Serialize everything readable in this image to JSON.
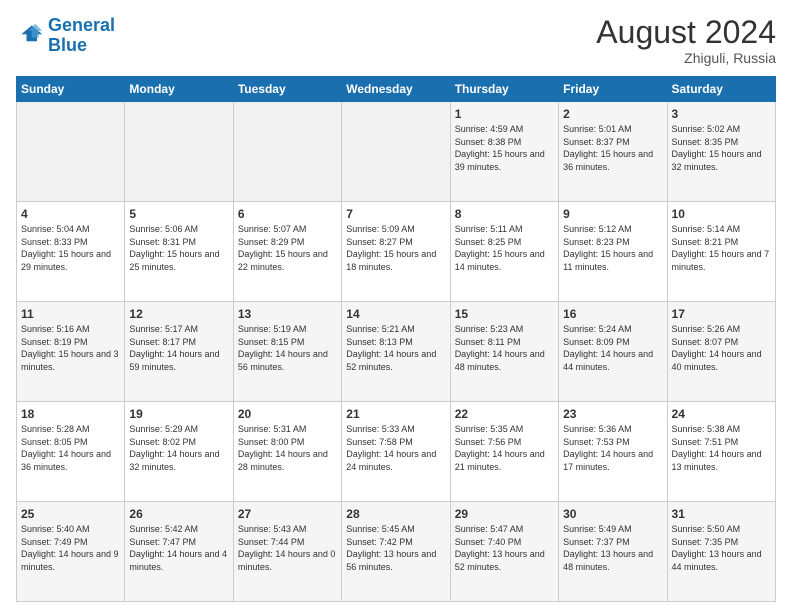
{
  "header": {
    "logo_line1": "General",
    "logo_line2": "Blue",
    "month_year": "August 2024",
    "location": "Zhiguli, Russia"
  },
  "weekdays": [
    "Sunday",
    "Monday",
    "Tuesday",
    "Wednesday",
    "Thursday",
    "Friday",
    "Saturday"
  ],
  "weeks": [
    [
      {
        "day": "",
        "info": ""
      },
      {
        "day": "",
        "info": ""
      },
      {
        "day": "",
        "info": ""
      },
      {
        "day": "",
        "info": ""
      },
      {
        "day": "1",
        "info": "Sunrise: 4:59 AM\nSunset: 8:38 PM\nDaylight: 15 hours and 39 minutes."
      },
      {
        "day": "2",
        "info": "Sunrise: 5:01 AM\nSunset: 8:37 PM\nDaylight: 15 hours and 36 minutes."
      },
      {
        "day": "3",
        "info": "Sunrise: 5:02 AM\nSunset: 8:35 PM\nDaylight: 15 hours and 32 minutes."
      }
    ],
    [
      {
        "day": "4",
        "info": "Sunrise: 5:04 AM\nSunset: 8:33 PM\nDaylight: 15 hours and 29 minutes."
      },
      {
        "day": "5",
        "info": "Sunrise: 5:06 AM\nSunset: 8:31 PM\nDaylight: 15 hours and 25 minutes."
      },
      {
        "day": "6",
        "info": "Sunrise: 5:07 AM\nSunset: 8:29 PM\nDaylight: 15 hours and 22 minutes."
      },
      {
        "day": "7",
        "info": "Sunrise: 5:09 AM\nSunset: 8:27 PM\nDaylight: 15 hours and 18 minutes."
      },
      {
        "day": "8",
        "info": "Sunrise: 5:11 AM\nSunset: 8:25 PM\nDaylight: 15 hours and 14 minutes."
      },
      {
        "day": "9",
        "info": "Sunrise: 5:12 AM\nSunset: 8:23 PM\nDaylight: 15 hours and 11 minutes."
      },
      {
        "day": "10",
        "info": "Sunrise: 5:14 AM\nSunset: 8:21 PM\nDaylight: 15 hours and 7 minutes."
      }
    ],
    [
      {
        "day": "11",
        "info": "Sunrise: 5:16 AM\nSunset: 8:19 PM\nDaylight: 15 hours and 3 minutes."
      },
      {
        "day": "12",
        "info": "Sunrise: 5:17 AM\nSunset: 8:17 PM\nDaylight: 14 hours and 59 minutes."
      },
      {
        "day": "13",
        "info": "Sunrise: 5:19 AM\nSunset: 8:15 PM\nDaylight: 14 hours and 56 minutes."
      },
      {
        "day": "14",
        "info": "Sunrise: 5:21 AM\nSunset: 8:13 PM\nDaylight: 14 hours and 52 minutes."
      },
      {
        "day": "15",
        "info": "Sunrise: 5:23 AM\nSunset: 8:11 PM\nDaylight: 14 hours and 48 minutes."
      },
      {
        "day": "16",
        "info": "Sunrise: 5:24 AM\nSunset: 8:09 PM\nDaylight: 14 hours and 44 minutes."
      },
      {
        "day": "17",
        "info": "Sunrise: 5:26 AM\nSunset: 8:07 PM\nDaylight: 14 hours and 40 minutes."
      }
    ],
    [
      {
        "day": "18",
        "info": "Sunrise: 5:28 AM\nSunset: 8:05 PM\nDaylight: 14 hours and 36 minutes."
      },
      {
        "day": "19",
        "info": "Sunrise: 5:29 AM\nSunset: 8:02 PM\nDaylight: 14 hours and 32 minutes."
      },
      {
        "day": "20",
        "info": "Sunrise: 5:31 AM\nSunset: 8:00 PM\nDaylight: 14 hours and 28 minutes."
      },
      {
        "day": "21",
        "info": "Sunrise: 5:33 AM\nSunset: 7:58 PM\nDaylight: 14 hours and 24 minutes."
      },
      {
        "day": "22",
        "info": "Sunrise: 5:35 AM\nSunset: 7:56 PM\nDaylight: 14 hours and 21 minutes."
      },
      {
        "day": "23",
        "info": "Sunrise: 5:36 AM\nSunset: 7:53 PM\nDaylight: 14 hours and 17 minutes."
      },
      {
        "day": "24",
        "info": "Sunrise: 5:38 AM\nSunset: 7:51 PM\nDaylight: 14 hours and 13 minutes."
      }
    ],
    [
      {
        "day": "25",
        "info": "Sunrise: 5:40 AM\nSunset: 7:49 PM\nDaylight: 14 hours and 9 minutes."
      },
      {
        "day": "26",
        "info": "Sunrise: 5:42 AM\nSunset: 7:47 PM\nDaylight: 14 hours and 4 minutes."
      },
      {
        "day": "27",
        "info": "Sunrise: 5:43 AM\nSunset: 7:44 PM\nDaylight: 14 hours and 0 minutes."
      },
      {
        "day": "28",
        "info": "Sunrise: 5:45 AM\nSunset: 7:42 PM\nDaylight: 13 hours and 56 minutes."
      },
      {
        "day": "29",
        "info": "Sunrise: 5:47 AM\nSunset: 7:40 PM\nDaylight: 13 hours and 52 minutes."
      },
      {
        "day": "30",
        "info": "Sunrise: 5:49 AM\nSunset: 7:37 PM\nDaylight: 13 hours and 48 minutes."
      },
      {
        "day": "31",
        "info": "Sunrise: 5:50 AM\nSunset: 7:35 PM\nDaylight: 13 hours and 44 minutes."
      }
    ]
  ]
}
